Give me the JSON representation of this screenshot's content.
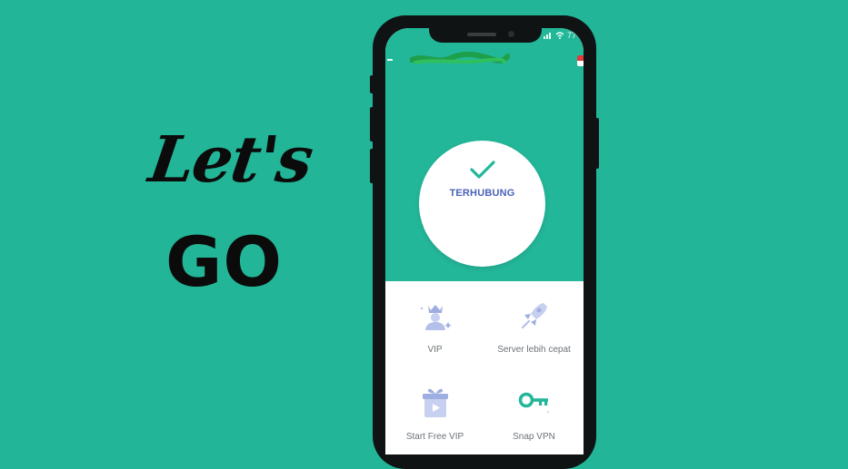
{
  "headline": {
    "line1": "Let's",
    "line2": "GO"
  },
  "status_bar": {
    "battery": "77"
  },
  "connection": {
    "status_label": "TERHUBUNG"
  },
  "features": [
    {
      "label": "VIP",
      "icon": "crown-person-icon"
    },
    {
      "label": "Server lebih cepat",
      "icon": "rocket-icon"
    },
    {
      "label": "Start Free VIP",
      "icon": "gift-video-icon"
    },
    {
      "label": "Snap VPN",
      "icon": "key-icon"
    }
  ],
  "colors": {
    "background": "#22b597",
    "accent": "#23b79a",
    "label_blue": "#4a62b8",
    "flag_red": "#e23a3a"
  }
}
